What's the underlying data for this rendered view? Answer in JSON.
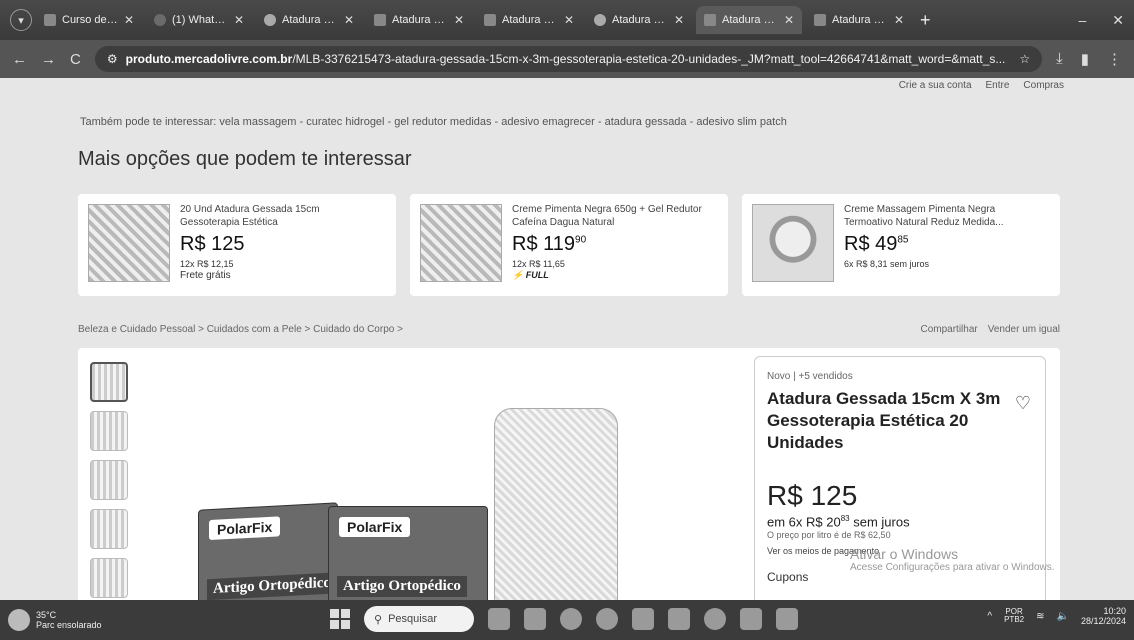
{
  "browser": {
    "tabs": [
      {
        "label": "Curso de em",
        "icon": "tab-icon",
        "active": false
      },
      {
        "label": "(1) WhatsAp",
        "icon": "whatsapp-icon",
        "active": false
      },
      {
        "label": "Atadura Ges",
        "icon": "google-icon",
        "active": false
      },
      {
        "label": "Atadura Ge",
        "icon": "tab-icon",
        "active": false
      },
      {
        "label": "Atadura Ges",
        "icon": "tab-icon",
        "active": false
      },
      {
        "label": "Atadura Ges",
        "icon": "google-icon",
        "active": false
      },
      {
        "label": "Atadura Ges",
        "icon": "tab-icon",
        "active": true
      },
      {
        "label": "Atadura Ge",
        "icon": "tab-icon",
        "active": false
      }
    ],
    "url_host": "produto.mercadolivre.com.br",
    "url_path": "/MLB-3376215473-atadura-gessada-15cm-x-3m-gessoterapia-estetica-20-unidades-_JM?matt_tool=42664741&matt_word=&matt_s..."
  },
  "page": {
    "header_links": [
      "Crie a sua conta",
      "Entre",
      "Compras"
    ],
    "suggest_prefix": "Também pode te interessar:",
    "suggest_links": "vela massagem - curatec hidrogel - gel redutor medidas - adesivo emagrecer - atadura gessada - adesivo slim patch",
    "more_title": "Mais opções que podem te interessar",
    "cards": [
      {
        "name": "20 Und Atadura Gessada 15cm Gessoterapia Estética",
        "price": "R$ 125",
        "cents": "",
        "installments": "12x R$ 12,15",
        "shipping": "Frete grátis",
        "full": ""
      },
      {
        "name": "Creme Pimenta Negra 650g + Gel Redutor Cafeína Dagua Natural",
        "price": "R$ 119",
        "cents": "90",
        "installments": "12x R$ 11,65",
        "shipping": "",
        "full": "⚡ FULL"
      },
      {
        "name": "Creme Massagem Pimenta Negra Termoativo Natural Reduz Medida...",
        "price": "R$ 49",
        "cents": "85",
        "installments": "6x R$ 8,31 sem juros",
        "shipping": "",
        "full": ""
      }
    ],
    "breadcrumb": "Beleza e Cuidado Pessoal > Cuidados com a Pele > Cuidado do Corpo >",
    "breadcrumb_right": [
      "Compartilhar",
      "Vender um igual"
    ],
    "product": {
      "condition": "Novo | +5 vendidos",
      "title": "Atadura Gessada 15cm X 3m Gessoterapia Estética 20 Unidades",
      "price": "R$ 125",
      "installments_prefix": "em 6x R$ 20",
      "installments_cents": "83",
      "installments_suffix": " sem juros",
      "per_liter": "O preço por litro é de R$ 62,50",
      "payment_link": "Ver os meios de pagamento",
      "coupons": "Cupons",
      "brand_1": "PolarFix",
      "brand_2": "PolarFix",
      "category_1": "Artigo Ortopédico",
      "category_2": "Artigo Ortopédico"
    },
    "activate_title": "Ativar o Windows",
    "activate_sub": "Acesse Configurações para ativar o Windows."
  },
  "taskbar": {
    "weather_temp": "35°C",
    "weather_desc": "Parc ensolarado",
    "search_placeholder": "Pesquisar",
    "lang_1": "POR",
    "lang_2": "PTB2",
    "time": "10:20",
    "date": "28/12/2024"
  }
}
